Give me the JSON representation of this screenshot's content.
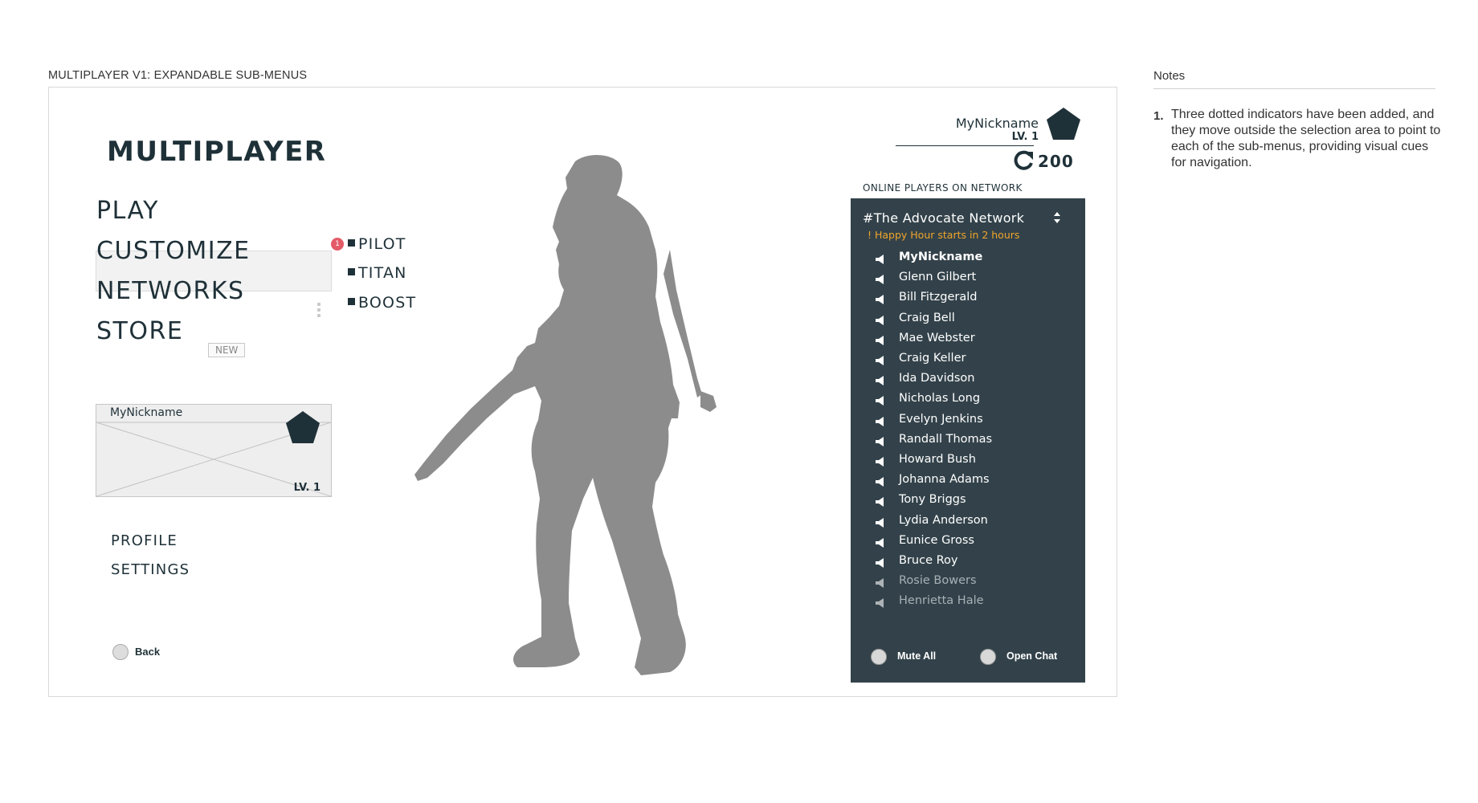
{
  "frame_title": "MULTIPLAYER V1: EXPANDABLE SUB-MENUS",
  "title": "MULTIPLAYER",
  "menu": {
    "play": "PLAY",
    "customize": "CUSTOMIZE",
    "networks": "NETWORKS",
    "store": "STORE",
    "store_badge": "NEW"
  },
  "submenu": {
    "notification_count": "1",
    "items": [
      "PILOT",
      "TITAN",
      "BOOST"
    ]
  },
  "card": {
    "nickname": "MyNickname",
    "level": "LV. 1"
  },
  "links": {
    "profile": "PROFILE",
    "settings": "SETTINGS",
    "back": "Back"
  },
  "player": {
    "nickname": "MyNickname",
    "level": "LV. 1",
    "currency": "200"
  },
  "online": {
    "label": "ONLINE PLAYERS ON NETWORK",
    "network": "#The Advocate Network",
    "notice": "! Happy Hour starts in 2 hours",
    "players": [
      "MyNickname",
      "Glenn Gilbert",
      "Bill Fitzgerald",
      "Craig Bell",
      "Mae Webster",
      "Craig Keller",
      "Ida Davidson",
      "Nicholas Long",
      "Evelyn Jenkins",
      "Randall Thomas",
      "Howard Bush",
      "Johanna Adams",
      "Tony Briggs",
      "Lydia Anderson",
      "Eunice Gross",
      "Bruce Roy",
      "Rosie Bowers",
      "Henrietta Hale"
    ],
    "mute_all": "Mute All",
    "open_chat": "Open Chat"
  },
  "notes": {
    "header": "Notes",
    "items": [
      {
        "num": "1.",
        "text": "Three dotted indicators have been added, and they move outside the selection area to point to each of the sub-menus, providing visual cues for navigation."
      }
    ]
  },
  "colors": {
    "dark": "#1f3138",
    "panel": "#33424a",
    "accent": "#f0a52a",
    "badge": "#e35b68",
    "silhouette": "#8c8c8c"
  },
  "icons": {
    "avatar": "pentagon-icon",
    "currency": "refresh-icon",
    "speaker": "speaker-icon",
    "sort": "sort-arrows-icon"
  }
}
